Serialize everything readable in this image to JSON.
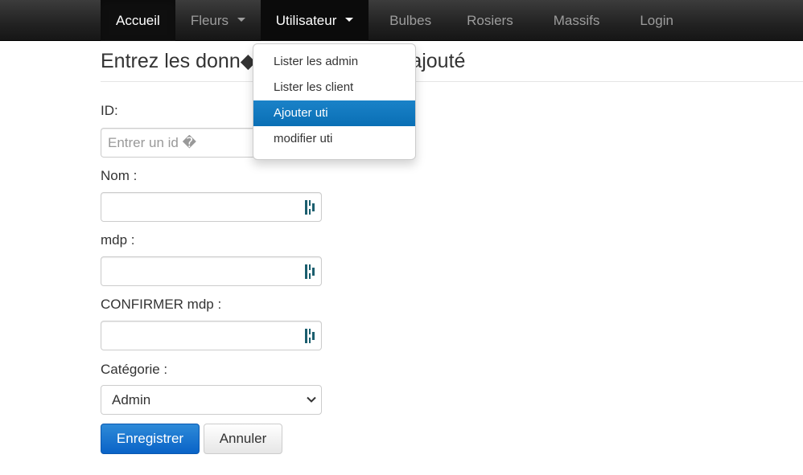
{
  "navbar": {
    "items": [
      {
        "label": "Accueil"
      },
      {
        "label": "Fleurs"
      },
      {
        "label": "Utilisateur"
      },
      {
        "label": "Bulbes"
      },
      {
        "label": "Rosiers"
      },
      {
        "label": "Massifs"
      },
      {
        "label": "Login"
      }
    ]
  },
  "dropdown": {
    "items": [
      {
        "label": "Lister les admin"
      },
      {
        "label": "Lister les client"
      },
      {
        "label": "Ajouter uti"
      },
      {
        "label": "modifier uti"
      }
    ]
  },
  "page": {
    "title": "Entrez les donn◆es de l'utilisateur ajouté"
  },
  "form": {
    "id_label": "ID:",
    "id_placeholder": "Entrer un id �",
    "id_value": "",
    "nom_label": "Nom :",
    "nom_value": "",
    "mdp_label": "mdp :",
    "mdp_value": "",
    "confirm_label": "CONFIRMER mdp :",
    "confirm_value": "",
    "categorie_label": "Catégorie :",
    "categorie_selected": "Admin",
    "submit_label": "Enregistrer",
    "cancel_label": "Annuler"
  },
  "colors": {
    "navbar_bg": "#222222",
    "menu_highlight": "#0a6fb5",
    "primary_button": "#0a63c7",
    "password_icon": "#1b5e6e"
  },
  "icons": {
    "password_manager": "password-manager-icon",
    "caret": "caret-down-icon",
    "select_chevron": "chevron-down-icon"
  }
}
